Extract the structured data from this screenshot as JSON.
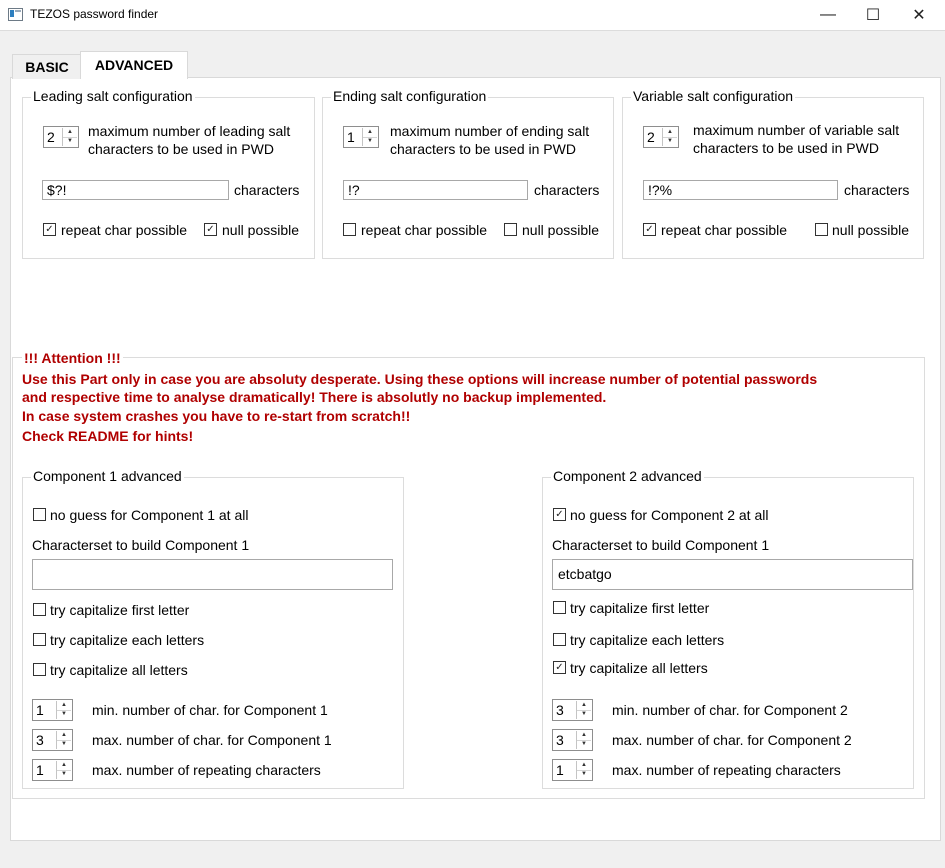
{
  "window": {
    "title": "TEZOS password finder",
    "minimize": "—",
    "maximize": "☐",
    "close": "✕"
  },
  "tabs": {
    "basic": "BASIC",
    "advanced": "ADVANCED"
  },
  "salt": {
    "leading": {
      "title": "Leading salt configuration",
      "spin_value": "2",
      "desc_line1": "maximum number of leading salt",
      "desc_line2": "characters to be used in PWD",
      "chars_value": "$?!",
      "chars_label": "characters",
      "repeat_label": "repeat char possible",
      "repeat_checked": true,
      "null_label": "null possible",
      "null_checked": true
    },
    "ending": {
      "title": "Ending salt configuration",
      "spin_value": "1",
      "desc_line1": "maximum number of ending salt",
      "desc_line2": "characters to be used in PWD",
      "chars_value": "!?",
      "chars_label": "characters",
      "repeat_label": "repeat char possible",
      "repeat_checked": false,
      "null_label": "null possible",
      "null_checked": false
    },
    "variable": {
      "title": "Variable salt configuration",
      "spin_value": "2",
      "desc_line1": "maximum number of variable salt",
      "desc_line2": "characters to be used in PWD",
      "chars_value": "!?%",
      "chars_label": "characters",
      "repeat_label": "repeat char possible",
      "repeat_checked": true,
      "null_label": "null possible",
      "null_checked": false
    }
  },
  "attention": {
    "title": "!!! Attention !!!",
    "line1": "Use this Part only in case you are absoluty desperate. Using these options will increase number of potential passwords",
    "line2": "and respective time to analyse dramatically! There is absolutly no backup implemented.",
    "line3": "In case system crashes you have to re-start from scratch!!",
    "line4": "Check README for hints!"
  },
  "comp1": {
    "title": "Component 1 advanced",
    "noguess_label": "no guess for Component 1 at all",
    "noguess_checked": false,
    "charset_label": "Characterset to build Component 1",
    "charset_value": "",
    "cap_first_label": "try capitalize first letter",
    "cap_first_checked": false,
    "cap_each_label": "try capitalize each letters",
    "cap_each_checked": false,
    "cap_all_label": "try capitalize all letters",
    "cap_all_checked": false,
    "min_value": "1",
    "min_label": "min. number of char. for Component 1",
    "max_value": "3",
    "max_label": "max. number of char. for Component 1",
    "rep_value": "1",
    "rep_label": "max. number of repeating characters"
  },
  "comp2": {
    "title": "Component 2 advanced",
    "noguess_label": "no guess for Component 2 at all",
    "noguess_checked": true,
    "charset_label": "Characterset to build Component 1",
    "charset_value": "etcbatgo",
    "cap_first_label": "try capitalize first letter",
    "cap_first_checked": false,
    "cap_each_label": "try capitalize each letters",
    "cap_each_checked": false,
    "cap_all_label": "try capitalize all letters",
    "cap_all_checked": true,
    "min_value": "3",
    "min_label": "min. number of char. for Component 2",
    "max_value": "3",
    "max_label": "max. number of char. for Component 2",
    "rep_value": "1",
    "rep_label": "max. number of repeating characters"
  },
  "icons": {
    "check": "✓",
    "spin_up": "▲",
    "spin_down": "▼"
  }
}
